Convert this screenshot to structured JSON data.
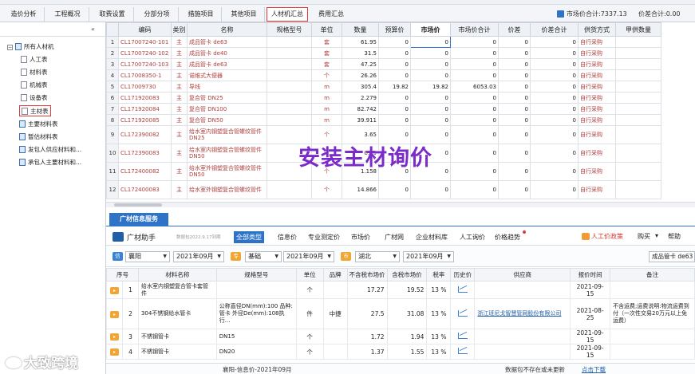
{
  "top_tabs": [
    "造价分析",
    "工程概况",
    "取费设置",
    "分部分项",
    "措施项目",
    "其他项目",
    "人材机汇总",
    "费用汇总"
  ],
  "active_top_tab": "人材机汇总",
  "market_total": "市场价合计:7337.13",
  "diff_total": "价差合计:0.00",
  "tree": {
    "root": "所有人材机",
    "children": [
      "人工表",
      "材料表",
      "机械表",
      "设备表",
      "主材表"
    ],
    "groups": [
      "主要材料表",
      "暂估材料表",
      "发包人供应材料和...",
      "承包人主要材料和..."
    ],
    "selected": "主材表"
  },
  "grid": {
    "headers": [
      "编码",
      "类别",
      "名称",
      "规格型号",
      "单位",
      "数量",
      "预算价",
      "市场价",
      "市场价合计",
      "价差",
      "价差合计",
      "供货方式",
      "甲供数量"
    ],
    "rows": [
      {
        "n": "1",
        "code": "CL17007240-101",
        "cat": "主",
        "name": "成品管卡 de63",
        "unit": "套",
        "qty": "61.95",
        "budget": "0",
        "market": "0",
        "total": "0",
        "diff": "0",
        "difftotal": "0",
        "supply": "自行采购"
      },
      {
        "n": "2",
        "code": "CL17007240-102",
        "cat": "主",
        "name": "成品管卡 de40",
        "unit": "套",
        "qty": "31.5",
        "budget": "0",
        "market": "0",
        "total": "0",
        "diff": "0",
        "difftotal": "0",
        "supply": "自行采购"
      },
      {
        "n": "3",
        "code": "CL17007240-103",
        "cat": "主",
        "name": "成品管卡 de63",
        "unit": "套",
        "qty": "47.25",
        "budget": "0",
        "market": "0",
        "total": "0",
        "diff": "0",
        "difftotal": "0",
        "supply": "自行采购"
      },
      {
        "n": "4",
        "code": "CL17008350-1",
        "cat": "主",
        "name": "诺维式大便器",
        "unit": "个",
        "qty": "26.26",
        "budget": "0",
        "market": "0",
        "total": "0",
        "diff": "0",
        "difftotal": "0",
        "supply": "自行采购"
      },
      {
        "n": "5",
        "code": "CL17009730",
        "cat": "主",
        "name": "导线",
        "unit": "m",
        "qty": "305.4",
        "budget": "19.82",
        "market": "19.82",
        "total": "6053.03",
        "diff": "0",
        "difftotal": "0",
        "supply": "自行采购"
      },
      {
        "n": "6",
        "code": "CL171920083",
        "cat": "主",
        "name": "复合管 DN25",
        "unit": "m",
        "qty": "2.279",
        "budget": "0",
        "market": "0",
        "total": "0",
        "diff": "0",
        "difftotal": "0",
        "supply": "自行采购"
      },
      {
        "n": "7",
        "code": "CL171920084",
        "cat": "主",
        "name": "复合管 DN100",
        "unit": "m",
        "qty": "82.742",
        "budget": "0",
        "market": "0",
        "total": "0",
        "diff": "0",
        "difftotal": "0",
        "supply": "自行采购"
      },
      {
        "n": "8",
        "code": "CL171920085",
        "cat": "主",
        "name": "复合管 DN50",
        "unit": "m",
        "qty": "39.911",
        "budget": "0",
        "market": "0",
        "total": "0",
        "diff": "0",
        "difftotal": "0",
        "supply": "自行采购"
      },
      {
        "n": "9",
        "code": "CL172390082",
        "cat": "主",
        "name": "给水室内钢塑复合管螺纹管件 DN25",
        "unit": "个",
        "qty": "3.65",
        "budget": "0",
        "market": "0",
        "total": "0",
        "diff": "0",
        "difftotal": "0",
        "supply": "自行采购",
        "tall": true
      },
      {
        "n": "10",
        "code": "CL172390083",
        "cat": "主",
        "name": "给水室内钢塑复合管螺纹管件 DN50",
        "unit": "个",
        "qty": "6.49",
        "budget": "0",
        "market": "0",
        "total": "0",
        "diff": "0",
        "difftotal": "0",
        "supply": "自行采购",
        "tall": true
      },
      {
        "n": "11",
        "code": "CL172400082",
        "cat": "主",
        "name": "给水室外钢塑复合管螺纹管件 DN50",
        "unit": "个",
        "qty": "1.158",
        "budget": "0",
        "market": "0",
        "total": "0",
        "diff": "0",
        "difftotal": "0",
        "supply": "自行采购",
        "tall": true
      },
      {
        "n": "12",
        "code": "CL172400083",
        "cat": "主",
        "name": "给水室外钢塑复合管螺纹管件",
        "unit": "个",
        "qty": "14.866",
        "budget": "0",
        "market": "0",
        "total": "0",
        "diff": "0",
        "difftotal": "0",
        "supply": "自行采购",
        "tall": true
      }
    ]
  },
  "overlay_text": "安装主材询价",
  "panel": {
    "tab_label": "广材信息服务",
    "assistant_title": "广材助手",
    "version": "数据包2022.9.17到期",
    "nav_tabs": [
      "全部类型",
      "信息价",
      "专业测定价",
      "市场价",
      "广材网",
      "企业材料库",
      "人工询价",
      "价格趋势"
    ],
    "active_nav": "全部类型",
    "promo": "人工价政策",
    "buy": "购买",
    "help": "帮助",
    "filters": {
      "region1": "襄阳",
      "period1": "2021年09月",
      "type": "基础",
      "period2": "2021年09月",
      "region2": "湖北",
      "period3": "2021年09月",
      "search": "成品管卡 de63"
    },
    "headers": [
      "序号",
      "材料名称",
      "规格型号",
      "单位",
      "品牌",
      "不含税市场价",
      "含税市场价",
      "税率",
      "历史价",
      "供应商",
      "报价时间",
      "备注"
    ],
    "rows": [
      {
        "n": "1",
        "name": "给水室内钢塑复合管卡套管件",
        "spec": "",
        "unit": "个",
        "brand": "",
        "price": "17.27",
        "taxprice": "19.52",
        "rate": "13 %",
        "supplier": "",
        "date": "2021-09-15",
        "note": ""
      },
      {
        "n": "2",
        "name": "304不锈钢给水管卡",
        "spec": "公称直径DN(mm):100 品种:管卡 外径De(mm):108执行...",
        "unit": "件",
        "brand": "中捷",
        "price": "27.5",
        "taxprice": "31.08",
        "rate": "13 %",
        "supplier": "浙江班尼戈智慧管网股份有限公司",
        "date": "2021-08-25",
        "note": "不含运费;运费说明:物流运费到付（一次性交易20万元以上免运费）"
      },
      {
        "n": "3",
        "name": "不锈钢管卡",
        "spec": "DN15",
        "unit": "个",
        "brand": "",
        "price": "1.72",
        "taxprice": "1.94",
        "rate": "13 %",
        "supplier": "",
        "date": "2021-09-15",
        "note": ""
      },
      {
        "n": "4",
        "name": "不锈钢管卡",
        "spec": "DN20",
        "unit": "个",
        "brand": "",
        "price": "1.37",
        "taxprice": "1.55",
        "rate": "13 %",
        "supplier": "",
        "date": "2021-09-15",
        "note": ""
      }
    ],
    "status_left": "襄阳-信息价-2021年09月",
    "status_mid": "数据包不存在或未更新",
    "status_link": "点击下载"
  },
  "watermark": "大致跨境"
}
